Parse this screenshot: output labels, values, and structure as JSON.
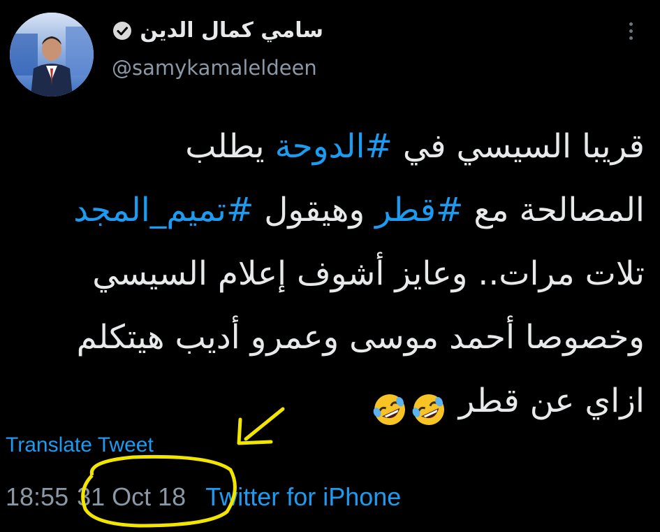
{
  "tweet": {
    "display_name": "سامي كمال الدين",
    "handle": "@samykamaleldeen",
    "text_lines": [
      [
        {
          "t": "قريبا السيسي في "
        },
        {
          "t": "#الدوحة",
          "tag": true
        },
        {
          "t": " يطلب"
        }
      ],
      [
        {
          "t": "المصالحة مع "
        },
        {
          "t": "#قطر",
          "tag": true
        },
        {
          "t": " وهيقول "
        },
        {
          "t": "#تميم_المجد",
          "tag": true
        }
      ],
      [
        {
          "t": "تلات مرات.. وعايز أشوف إعلام السيسي"
        }
      ],
      [
        {
          "t": "وخصوصا أحمد موسى وعمرو أديب هيتكلم"
        }
      ],
      [
        {
          "t": "ازاي عن قطر "
        }
      ]
    ],
    "emojis": [
      "rolling-on-floor-laughing-icon",
      "rolling-on-floor-laughing-icon"
    ],
    "translate_label": "Translate Tweet",
    "time": "18:55",
    "date": "31 Oct 18",
    "source": "Twitter for iPhone"
  },
  "colors": {
    "background": "#000000",
    "text": "#e7e9ea",
    "hashtag": "#1d9bf0",
    "muted": "#8b98a5",
    "annotation": "#f2e600"
  },
  "icons": {
    "verified": "verified-badge-icon",
    "more": "more-vertical-icon",
    "annotation_arrow": "arrow-annotation-icon"
  }
}
